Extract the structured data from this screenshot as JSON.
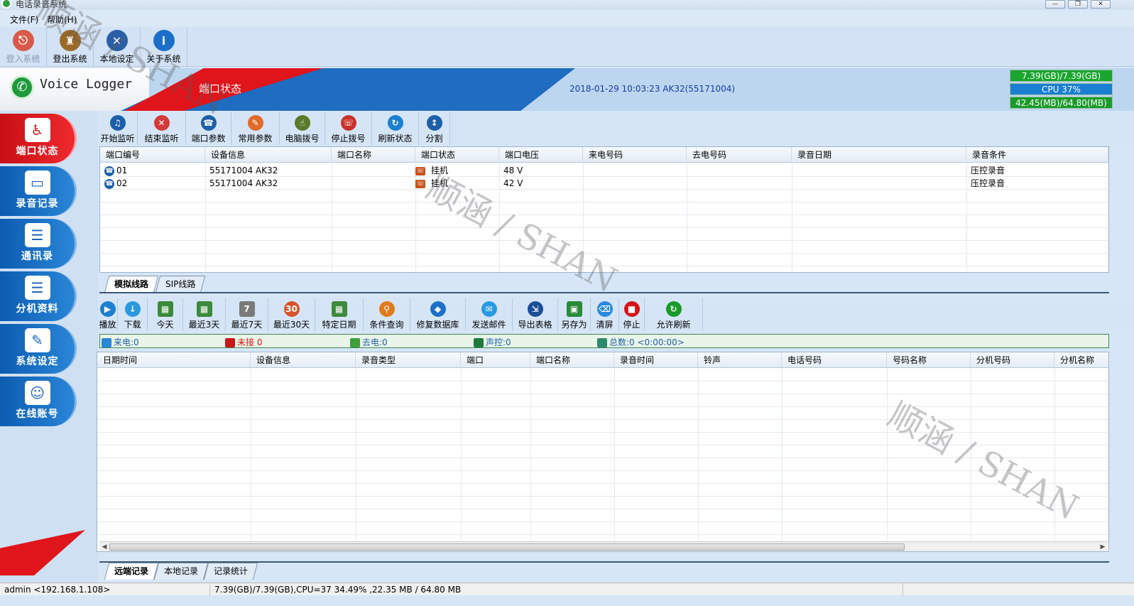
{
  "window": {
    "title": "电话录音系统",
    "btn_min": "—",
    "btn_max": "❐",
    "btn_close": "✕"
  },
  "menu": {
    "file": "文件(F)",
    "help": "帮助(H)"
  },
  "main_toolbar": [
    {
      "label": "登入系统",
      "glyph": "⎋",
      "color": "#d95a4a"
    },
    {
      "label": "登出系统",
      "glyph": "♜",
      "color": "#9a6a2a"
    },
    {
      "label": "本地设定",
      "glyph": "✕",
      "color": "#2a5fa5"
    },
    {
      "label": "关于系统",
      "glyph": "i",
      "color": "#1c6fc8"
    }
  ],
  "banner": {
    "brand": "Voice Logger",
    "section": "端口状态",
    "datetime": "2018-01-29 10:03:23 AK32(55171004)",
    "stats": [
      "7.39(GB)/7.39(GB)",
      "CPU 37%",
      "42.45(MB)/64.80(MB)"
    ],
    "stat_colors": [
      "#1aa52e",
      "#1a7fd0",
      "#1a9a2a"
    ]
  },
  "nav": [
    {
      "label": "端口状态",
      "glyph": "♿"
    },
    {
      "label": "录音记录",
      "glyph": "▭"
    },
    {
      "label": "通讯录",
      "glyph": "☰"
    },
    {
      "label": "分机资料",
      "glyph": "☰"
    },
    {
      "label": "系统设定",
      "glyph": "✎"
    },
    {
      "label": "在线账号",
      "glyph": "☺"
    }
  ],
  "port_toolbar": [
    {
      "label": "开始监听",
      "glyph": "♫",
      "color": "#1d5fa8"
    },
    {
      "label": "结束监听",
      "glyph": "✕",
      "color": "#d43a3a"
    },
    {
      "label": "端口参数",
      "glyph": "☎",
      "color": "#1d5fa8"
    },
    {
      "label": "常用参数",
      "glyph": "✎",
      "color": "#e06a2a"
    },
    {
      "label": "电脑拨号",
      "glyph": "☝",
      "color": "#5a7a2a"
    },
    {
      "label": "停止拨号",
      "glyph": "☏",
      "color": "#c8322a"
    },
    {
      "label": "刷新状态",
      "glyph": "↻",
      "color": "#1d7fd0"
    },
    {
      "label": "分割",
      "glyph": "↕",
      "color": "#1d5fa8"
    }
  ],
  "port_table": {
    "headers": [
      "端口编号",
      "设备信息",
      "端口名称",
      "端口状态",
      "端口电压",
      "来电号码",
      "去电号码",
      "录音日期",
      "录音条件"
    ],
    "rows": [
      {
        "port": "01",
        "device": "55171004 AK32",
        "name": "",
        "status": "挂机",
        "voltage": "48 V",
        "incoming": "",
        "outgoing": "",
        "date": "",
        "cond": "压控录音"
      },
      {
        "port": "02",
        "device": "55171004 AK32",
        "name": "",
        "status": "挂机",
        "voltage": "42 V",
        "incoming": "",
        "outgoing": "",
        "date": "",
        "cond": "压控录音"
      }
    ]
  },
  "line_tabs": [
    "模拟线路",
    "SIP线路"
  ],
  "record_toolbar": [
    {
      "label": "播放",
      "glyph": "▶",
      "color": "#1d7fd0"
    },
    {
      "label": "下载",
      "glyph": "↓",
      "color": "#2a9ae0"
    },
    {
      "label": "今天",
      "glyph": "▦",
      "color": "#3c8a3c"
    },
    {
      "label": "最近3天",
      "glyph": "▦",
      "color": "#3c8a3c"
    },
    {
      "label": "最近7天",
      "glyph": "7",
      "color": "#7a7a7a"
    },
    {
      "label": "最近30天",
      "glyph": "30",
      "color": "#d8542a"
    },
    {
      "label": "特定日期",
      "glyph": "▦",
      "color": "#3c8a3c"
    },
    {
      "label": "条件查询",
      "glyph": "⚲",
      "color": "#e07a1a"
    },
    {
      "label": "修复数据库",
      "glyph": "◆",
      "color": "#1d6fc8"
    },
    {
      "label": "发送邮件",
      "glyph": "✉",
      "color": "#2a9ae0"
    },
    {
      "label": "导出表格",
      "glyph": "⇲",
      "color": "#1d4f98"
    },
    {
      "label": "另存为",
      "glyph": "▣",
      "color": "#2a8a3a"
    },
    {
      "label": "清屏",
      "glyph": "⌫",
      "color": "#2a8ae0"
    },
    {
      "label": "停止",
      "glyph": "■",
      "color": "#d41419"
    },
    {
      "label": "允许刷新",
      "glyph": "↻",
      "color": "#1a9a2a"
    }
  ],
  "counters": [
    {
      "label": "来电:0",
      "color": "#1d5fa8",
      "icon_color": "#2a86d8"
    },
    {
      "label": "未接 0",
      "color": "#d41419",
      "icon_color": "#c8161b"
    },
    {
      "label": "去电:0",
      "color": "#1d5fa8",
      "icon_color": "#3ca03c"
    },
    {
      "label": "声控:0",
      "color": "#1d5fa8",
      "icon_color": "#1e7a3a"
    },
    {
      "label": "总数:0 <0:00:00>",
      "color": "#1d5fa8",
      "icon_color": "#2a8a6a"
    }
  ],
  "record_table": {
    "headers": [
      "日期时间",
      "设备信息",
      "录音类型",
      "端口",
      "端口名称",
      "录音时间",
      "铃声",
      "电话号码",
      "号码名称",
      "分机号码",
      "分机名称"
    ]
  },
  "record_tabs": [
    "远端记录",
    "本地记录",
    "记录统计"
  ],
  "statusbar": {
    "user": "admin <192.168.1.108>",
    "info": "7.39(GB)/7.39(GB),CPU=37 34.49% ,22.35 MB / 64.80 MB"
  },
  "watermark": "顺涵 / SHAN"
}
